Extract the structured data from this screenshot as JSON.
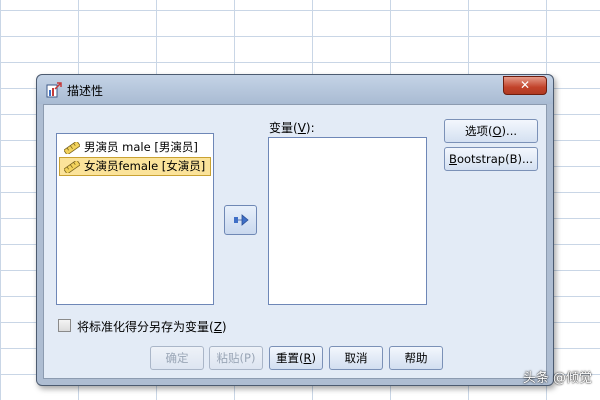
{
  "dialog": {
    "title": "描述性",
    "close_icon": "close-icon",
    "colors": {
      "titlebar": "#b5c5db",
      "client": "#e3ebf6",
      "selection": "#fbe39a"
    }
  },
  "source_list": {
    "items": [
      {
        "label": "男演员 male [男演员]",
        "icon": "scale-ruler-icon",
        "selected": false
      },
      {
        "label": "女演员female [女演员]",
        "icon": "scale-ruler-icon",
        "selected": true
      }
    ]
  },
  "move_button": {
    "icon": "arrow-right-icon"
  },
  "variables": {
    "label_prefix": "变量(",
    "label_mnemonic": "V",
    "label_suffix": "):"
  },
  "side_buttons": {
    "options_prefix": "选项(",
    "options_mnemonic": "O",
    "options_suffix": ")...",
    "bootstrap_mnemonic": "B",
    "bootstrap_rest": "ootstrap(B)..."
  },
  "checkbox": {
    "prefix": "将标准化得分另存为变量(",
    "mnemonic": "Z",
    "suffix": ")",
    "checked": false
  },
  "buttons": {
    "ok": "确定",
    "paste": "粘贴(P)",
    "reset_prefix": "重置(",
    "reset_mnemonic": "R",
    "reset_suffix": ")",
    "cancel": "取消",
    "help": "帮助"
  },
  "watermark": "头条 @倾觉"
}
